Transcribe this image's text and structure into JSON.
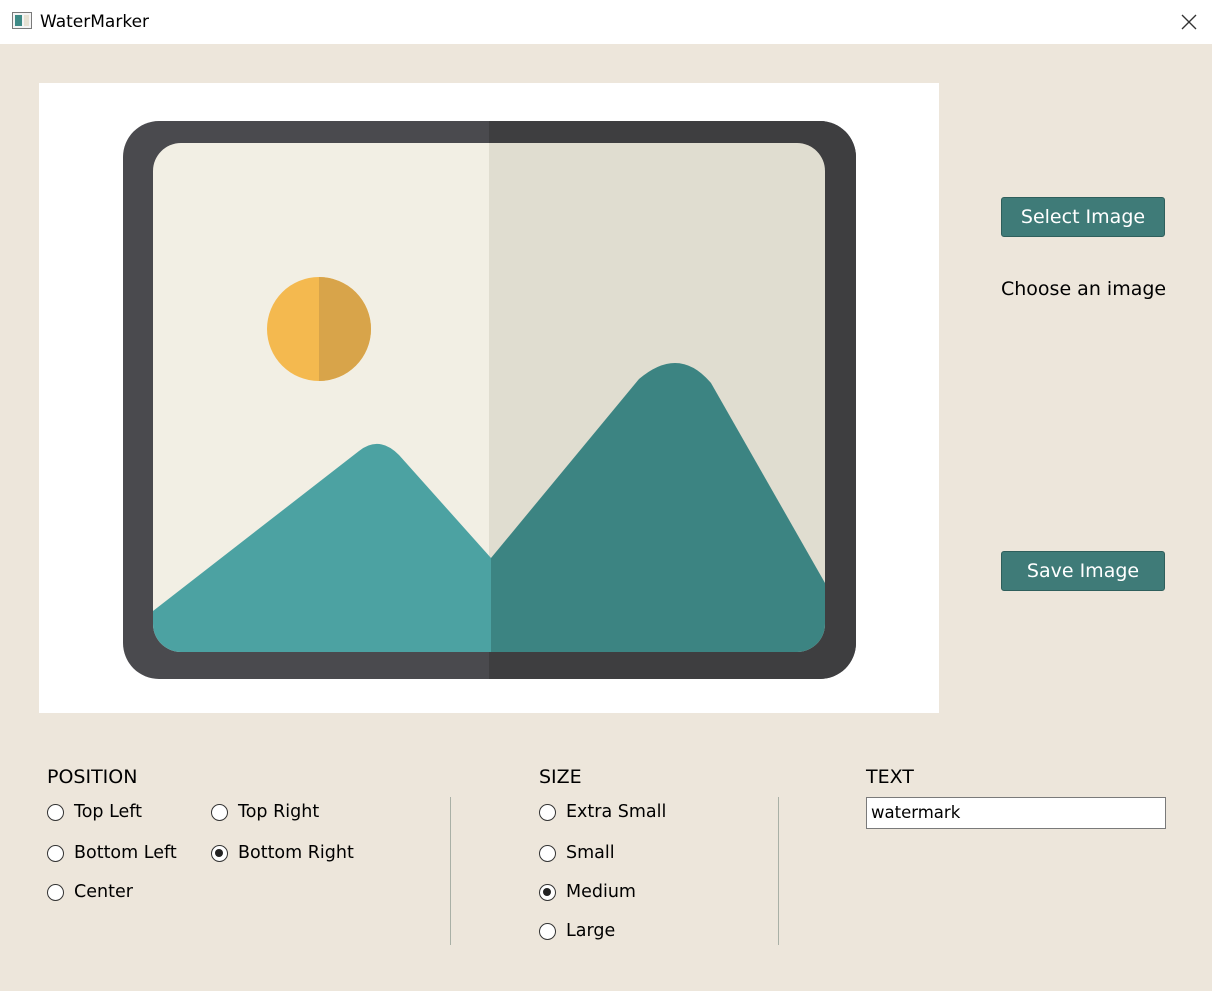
{
  "window": {
    "title": "WaterMarker",
    "close_icon": "close-icon",
    "app_icon": "app-image-icon"
  },
  "preview": {
    "placeholder_icon": "image-placeholder-icon"
  },
  "actions": {
    "select_label": "Select Image",
    "status_text": "Choose an image",
    "save_label": "Save Image"
  },
  "position": {
    "title": "POSITION",
    "options": [
      "Top Left",
      "Top Right",
      "Bottom Left",
      "Bottom Right",
      "Center"
    ],
    "selected": "Bottom Right"
  },
  "size": {
    "title": "SIZE",
    "options": [
      "Extra Small",
      "Small",
      "Medium",
      "Large"
    ],
    "selected": "Medium"
  },
  "text": {
    "title": "TEXT",
    "value": "watermark"
  },
  "colors": {
    "background": "#ede6db",
    "accent": "#3f7b78",
    "frame_dark": "#4a4a4e",
    "sun": "#f4b94f",
    "mountain": "#4ca2a2"
  }
}
